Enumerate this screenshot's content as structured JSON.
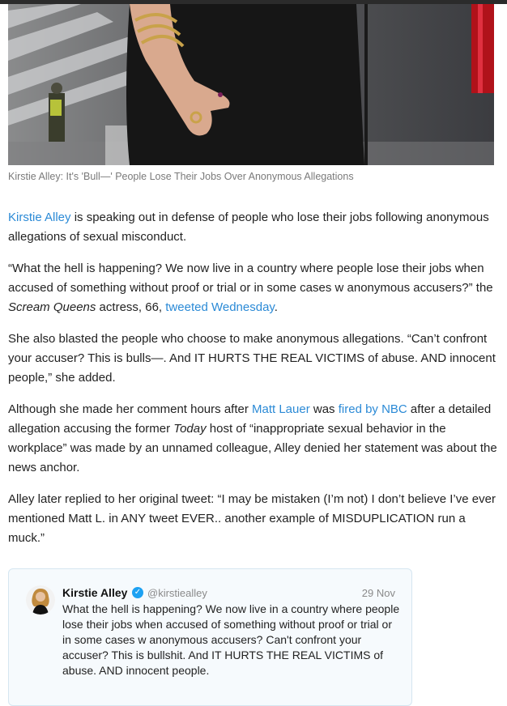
{
  "photo": {
    "alt": ""
  },
  "caption": "Kirstie Alley: It's 'Bull—' People Lose Their Jobs Over Anonymous Allegations",
  "p1": {
    "link": "Kirstie Alley",
    "text": " is speaking out in defense of people who lose their jobs following anonymous allegations of sexual misconduct."
  },
  "p2": {
    "quote": "“What the hell is happening? We now live in a country where people lose their jobs when accused of something without proof or trial or in some cases w anonymous accusers?” the ",
    "show": "Scream Queens",
    "mid": " actress, 66, ",
    "link": "tweeted Wednesday",
    "end": "."
  },
  "p3": {
    "text": "She also blasted the people who choose to make anonymous allegations. “Can’t confront your accuser? This is bulls—. And IT HURTS THE REAL VICTIMS of abuse. AND innocent people,” she added."
  },
  "p4": {
    "a": "Although she made her comment hours after ",
    "link1": "Matt Lauer",
    "b": " was ",
    "link2": "fired by NBC",
    "c": " after a detailed allegation accusing the former ",
    "show": "Today",
    "d": " host of “inappropriate sexual behavior in the workplace” was made by an unnamed colleague, Alley denied her statement was about the news anchor."
  },
  "p5": {
    "text": "Alley later replied to her original tweet: “I may be mistaken (I’m not) I don’t believe I’ve ever mentioned Matt L. in ANY tweet EVER.. another example of MISDUPLICATION run a muck.”"
  },
  "tweet": {
    "name": "Kirstie Alley",
    "verified_icon": "verified-badge-icon",
    "verified_glyph": "✓",
    "handle": "@kirstiealley",
    "date": "29 Nov",
    "text": "What the hell is happening? We now live in a country where people lose their jobs when accused of something without proof or trial or in some cases w anonymous accusers? Can't confront your accuser? This is bullshit. And IT HURTS THE REAL VICTIMS of abuse. AND innocent people."
  },
  "colors": {
    "link": "#2b8ad6",
    "verified": "#1da1f2",
    "tweet_bg": "#f6fafd",
    "tweet_border": "#d5e6f1"
  }
}
